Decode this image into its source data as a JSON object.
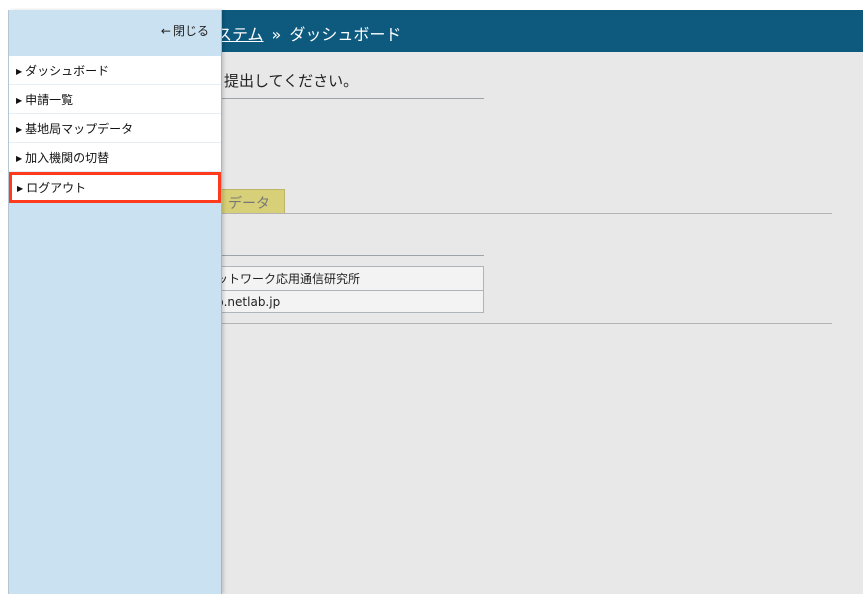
{
  "header": {
    "breadcrumb_link": "ステム",
    "separator": "»",
    "current": "ダッシュボード"
  },
  "sidebar": {
    "close_label": "閉じる",
    "items": [
      {
        "label": "ダッシュボード"
      },
      {
        "label": "申請一覧"
      },
      {
        "label": "基地局マップデータ"
      },
      {
        "label": "加入機関の切替"
      },
      {
        "label": "ログアウト"
      }
    ]
  },
  "main": {
    "notice": "、提出してください。",
    "tab_label": "データ",
    "table": [
      {
        "value": "ットワーク応用通信研究所"
      },
      {
        "value": "p.netlab.jp"
      }
    ]
  },
  "colors": {
    "header_bg": "#0d5a7e",
    "sidebar_bg": "#c9e1f1",
    "highlight": "#ff3b1f",
    "tab_bg": "#d7d078"
  }
}
